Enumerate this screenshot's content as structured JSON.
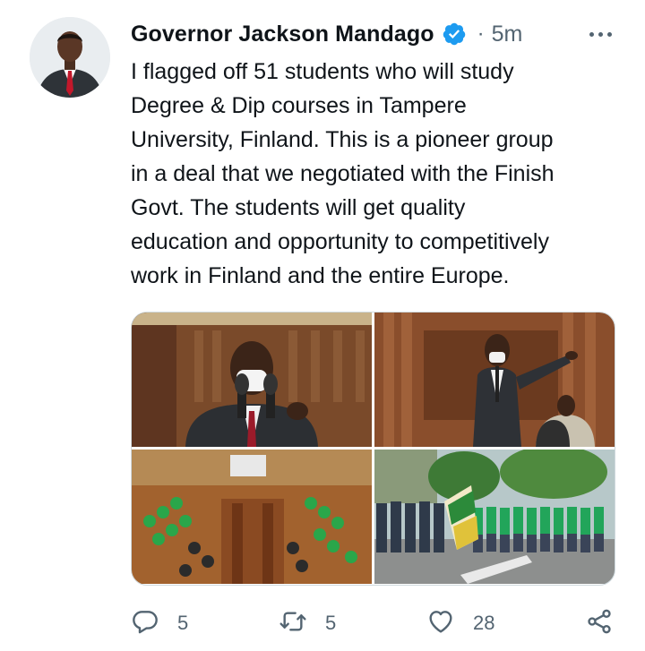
{
  "author": {
    "name": "Governor Jackson Mandago",
    "verified_icon": "verified-badge-icon",
    "separator": "·",
    "time": "5m"
  },
  "tweet": {
    "text": "I flagged off 51 students who will study\nDegree & Dip courses in Tampere\nUniversity, Finland. This is a pioneer group\nin a deal that we negotiated with the Finish\nGovt. The students will get quality\neducation and opportunity to competitively\nwork in Finland and the entire Europe."
  },
  "media": {
    "photos": [
      "governor-speaking-photo",
      "governor-gesturing-photo",
      "assembly-hall-photo",
      "flag-off-outdoor-photo"
    ]
  },
  "actions": {
    "reply_count": "5",
    "retweet_count": "5",
    "like_count": "28"
  },
  "colors": {
    "text": "#0f1419",
    "secondary": "#536471",
    "verified": "#1d9bf0",
    "border": "#cfd9de"
  }
}
